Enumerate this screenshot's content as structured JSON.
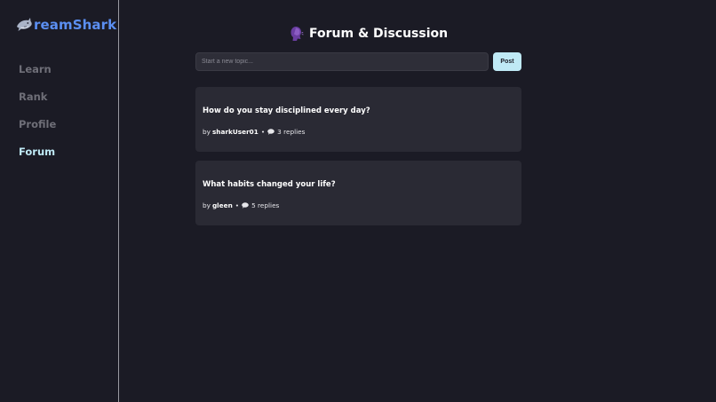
{
  "brand": {
    "name": "reamShark",
    "icon": "shark-icon",
    "color": "#5b8ff2"
  },
  "sidebar": {
    "items": [
      {
        "label": "Learn",
        "active": false
      },
      {
        "label": "Rank",
        "active": false
      },
      {
        "label": "Profile",
        "active": false
      },
      {
        "label": "Forum",
        "active": true
      }
    ],
    "active_color": "#bfe9f5"
  },
  "header": {
    "icon": "speaking-head-icon",
    "title": "Forum & Discussion"
  },
  "composer": {
    "placeholder": "Start a new topic...",
    "value": "",
    "post_label": "Post"
  },
  "topics": [
    {
      "title": "How do you stay disciplined every day?",
      "by_label": "by",
      "author": "sharkUser01",
      "separator": "•",
      "replies_icon": "speech-bubble-icon",
      "replies_text": "3 replies"
    },
    {
      "title": "What habits changed your life?",
      "by_label": "by",
      "author": "gleen",
      "separator": "•",
      "replies_icon": "speech-bubble-icon",
      "replies_text": "5 replies"
    }
  ]
}
